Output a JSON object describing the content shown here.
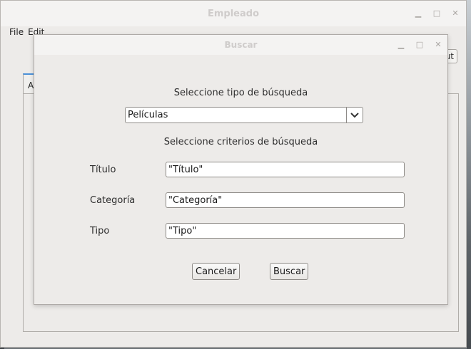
{
  "main_window": {
    "title": "Empleado",
    "menu": [
      "File",
      "Edit"
    ],
    "right_button_text": "ut",
    "tab_label": "A"
  },
  "dialog": {
    "title": "Buscar",
    "search_type_heading": "Seleccione tipo de búsqueda",
    "search_type_selected": "Películas",
    "criteria_heading": "Seleccione criterios de búsqueda",
    "fields": [
      {
        "label": "Título",
        "value": "\"Título\""
      },
      {
        "label": "Categoría",
        "value": "\"Categoría\""
      },
      {
        "label": "Tipo",
        "value": "\"Tipo\""
      }
    ],
    "cancel_label": "Cancelar",
    "search_label": "Buscar"
  },
  "icons": {
    "minimize": "minimize-icon",
    "maximize": "maximize-icon",
    "close": "close-icon",
    "dropdown": "chevron-down-icon"
  }
}
